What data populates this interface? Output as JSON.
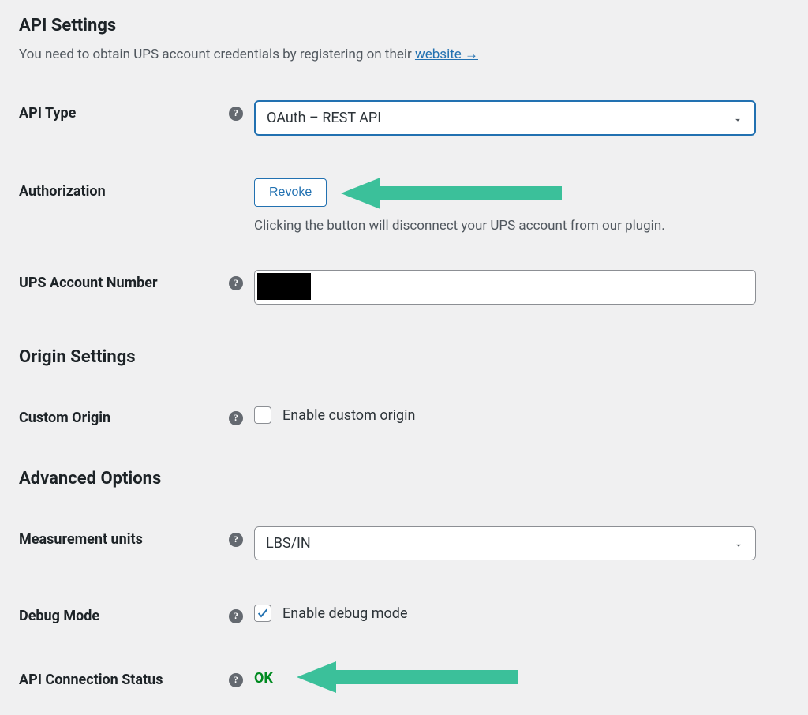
{
  "sections": {
    "api_settings": {
      "heading": "API Settings",
      "description_prefix": "You need to obtain UPS account credentials by registering on their ",
      "description_link": "website →"
    },
    "origin_settings": {
      "heading": "Origin Settings"
    },
    "advanced_options": {
      "heading": "Advanced Options"
    }
  },
  "fields": {
    "api_type": {
      "label": "API Type",
      "value": "OAuth – REST API"
    },
    "authorization": {
      "label": "Authorization",
      "button": "Revoke",
      "hint": "Clicking the button will disconnect your UPS account from our plugin."
    },
    "ups_account_number": {
      "label": "UPS Account Number",
      "value": ""
    },
    "custom_origin": {
      "label": "Custom Origin",
      "checkbox_label": "Enable custom origin",
      "checked": false
    },
    "measurement_units": {
      "label": "Measurement units",
      "value": "LBS/IN"
    },
    "debug_mode": {
      "label": "Debug Mode",
      "checkbox_label": "Enable debug mode",
      "checked": true
    },
    "api_connection_status": {
      "label": "API Connection Status",
      "value": "OK"
    }
  }
}
